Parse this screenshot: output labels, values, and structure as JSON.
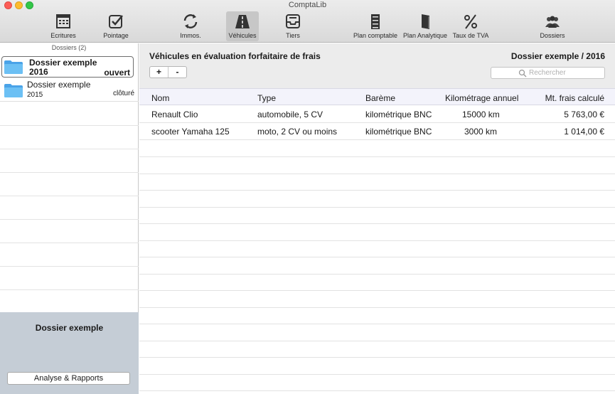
{
  "window": {
    "title": "ComptaLib"
  },
  "toolbar": {
    "ecritures": "Ecritures",
    "pointage": "Pointage",
    "immos": "Immos.",
    "vehicules": "Véhicules",
    "tiers": "Tiers",
    "plan_comptable": "Plan comptable",
    "plan_analytique": "Plan Analytique",
    "taux_tva": "Taux de TVA",
    "dossiers": "Dossiers",
    "active_item": "vehicules"
  },
  "sidebar": {
    "header": "Dossiers (2)",
    "dossiers": [
      {
        "name": "Dossier exemple",
        "year": "2016",
        "status": "ouvert",
        "selected": true
      },
      {
        "name": "Dossier exemple",
        "year": "2015",
        "status": "clôturé",
        "selected": false
      }
    ],
    "bottom_title": "Dossier exemple",
    "report_button": "Analyse & Rapports"
  },
  "main": {
    "title": "Véhicules en évaluation forfaitaire de frais",
    "context": "Dossier exemple / 2016",
    "add_label": "+",
    "remove_label": "-",
    "search_placeholder": "Rechercher",
    "columns": [
      "Nom",
      "Type",
      "Barème",
      "Kilométrage annuel",
      "Mt. frais calculé"
    ],
    "rows": [
      [
        "Renault Clio",
        "automobile, 5 CV",
        "kilométrique BNC",
        "15000 km",
        "5 763,00 €"
      ],
      [
        "scooter Yamaha 125",
        "moto, 2 CV ou moins",
        "kilométrique BNC",
        "3000 km",
        "1 014,00 €"
      ]
    ]
  },
  "colors": {
    "folder_blue": "#5fb4ef",
    "sidebar_bottom": "#c5cdd6",
    "table_header": "#f3f3fb"
  }
}
